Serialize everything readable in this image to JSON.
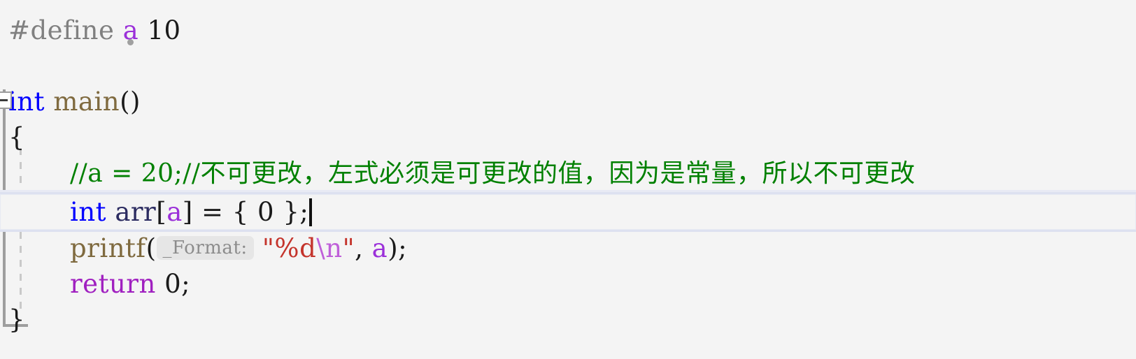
{
  "editor": {
    "background_color": "#f4f4f4",
    "language": "C",
    "current_line_number": 6,
    "caret_visible": true
  },
  "gutter": {
    "collapse_icon": "collapse-minus-icon",
    "collapse_state": "expanded",
    "indent_guide": "dashed"
  },
  "colors": {
    "background": "#f4f4f4",
    "preprocessor": "#808080",
    "keyword": "#0000ff",
    "macro": "#9b30d9",
    "function": "#7f6a3f",
    "comment": "#008000",
    "string": "#c4342c",
    "escape": "#bf5fd9",
    "return_keyword": "#a020c0",
    "identifier": "#2b2b60",
    "plain": "#1a1a1a",
    "inlay_hint_text": "#8c8c8c",
    "inlay_hint_background": "#e6e6e6",
    "current_line_border": "#dde1f0",
    "outline_bar": "#9e9e9e",
    "indent_guide": "#c9c9c9"
  },
  "code": {
    "line1": {
      "directive": "#define",
      "macro_name": "a",
      "macro_value": "10"
    },
    "line3": {
      "keyword": "int",
      "function_name": "main",
      "parens": "()"
    },
    "line4": {
      "open_brace": "{"
    },
    "line5": {
      "comment": "//a = 20;//不可更改，左式必须是可更改的值，因为是常量，所以不可更改"
    },
    "line6": {
      "keyword": "int",
      "identifier": "arr",
      "bracket_open": "[",
      "index": "a",
      "bracket_close": "]",
      "assign": " = ",
      "init": "{ 0 }",
      "semicolon": ";"
    },
    "line7": {
      "function_name": "printf",
      "paren_open": "(",
      "inlay_hint": "_Format:",
      "string_start": "\"%d",
      "escape": "\\n",
      "string_end": "\"",
      "comma": ", ",
      "argument": "a",
      "paren_close": ")",
      "semicolon": ";"
    },
    "line8": {
      "keyword": "return",
      "value": "0",
      "semicolon": ";"
    },
    "line9": {
      "close_brace": "}"
    }
  }
}
